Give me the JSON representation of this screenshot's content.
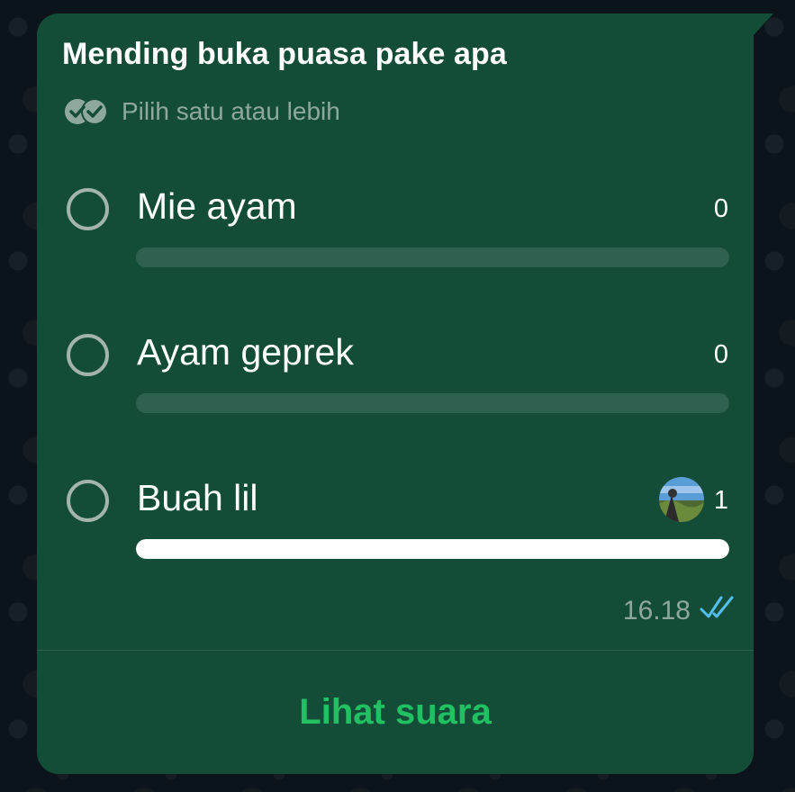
{
  "poll": {
    "question": "Mending buka puasa pake apa",
    "hint": "Pilih satu atau lebih",
    "options": [
      {
        "label": "Mie ayam",
        "count": "0",
        "fraction": 0
      },
      {
        "label": "Ayam geprek",
        "count": "0",
        "fraction": 0
      },
      {
        "label": "Buah lil",
        "count": "1",
        "fraction": 1
      }
    ],
    "time": "16.18",
    "status_icon": "double-check-read-icon",
    "view_votes_label": "Lihat suara"
  },
  "colors": {
    "bubble": "#144d37",
    "accent": "#21c063",
    "read_ticks": "#53bdeb",
    "muted_text": "#8fa89c"
  }
}
